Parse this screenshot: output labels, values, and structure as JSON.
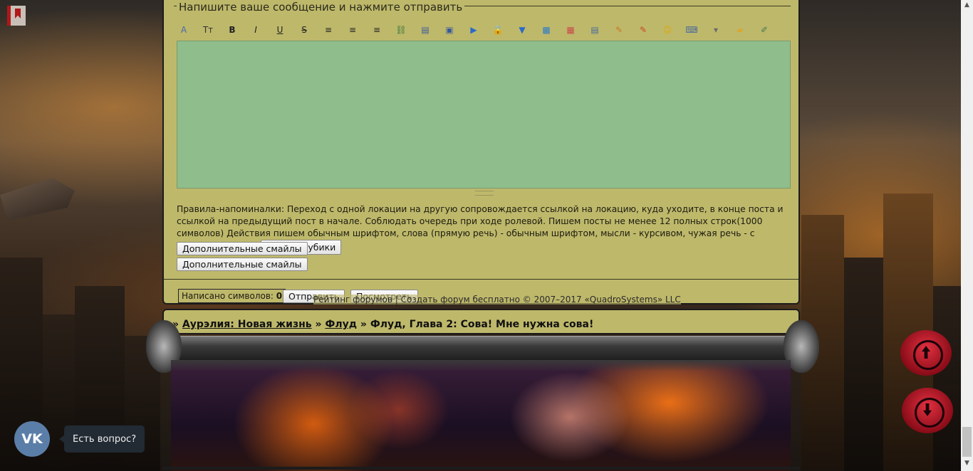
{
  "form": {
    "legend": "Напишите ваше сообщение и нажмите отправить",
    "toolbar": [
      {
        "icon": "font-color-icon",
        "glyph": "A",
        "color": "#4a6aa8"
      },
      {
        "icon": "font-size-icon",
        "glyph": "Tт",
        "color": "#333333"
      },
      {
        "icon": "bold-icon",
        "glyph": "B",
        "color": "#222222"
      },
      {
        "icon": "italic-icon",
        "glyph": "I",
        "color": "#222222"
      },
      {
        "icon": "underline-icon",
        "glyph": "U",
        "color": "#222222"
      },
      {
        "icon": "strikethrough-icon",
        "glyph": "S",
        "color": "#222222"
      },
      {
        "icon": "align-left-icon",
        "glyph": "≡",
        "color": "#222222"
      },
      {
        "icon": "align-center-icon",
        "glyph": "≡",
        "color": "#222222"
      },
      {
        "icon": "align-right-icon",
        "glyph": "≡",
        "color": "#222222"
      },
      {
        "icon": "link-icon",
        "glyph": "⛓",
        "color": "#3a7a3a"
      },
      {
        "icon": "book-icon",
        "glyph": "▤",
        "color": "#3a5a9a"
      },
      {
        "icon": "image-icon",
        "glyph": "▣",
        "color": "#3a5a9a"
      },
      {
        "icon": "video-icon",
        "glyph": "▶",
        "color": "#2a6ac8"
      },
      {
        "icon": "lock-icon",
        "glyph": "🔒",
        "color": "#c89a20"
      },
      {
        "icon": "quote-icon",
        "glyph": "▼",
        "color": "#2a6ac8"
      },
      {
        "icon": "code-icon",
        "glyph": "▩",
        "color": "#2a7ac8"
      },
      {
        "icon": "color-palette-icon",
        "glyph": "▦",
        "color": "#c84a4a"
      },
      {
        "icon": "table-icon",
        "glyph": "▤",
        "color": "#4a6a9a"
      },
      {
        "icon": "pencil-icon",
        "glyph": "✎",
        "color": "#c87a20"
      },
      {
        "icon": "marker-icon",
        "glyph": "✎",
        "color": "#c84a20"
      },
      {
        "icon": "smiley-icon",
        "glyph": "☺",
        "color": "#e0a800"
      },
      {
        "icon": "keyboard-icon",
        "glyph": "⌨",
        "color": "#4a6a9a"
      },
      {
        "icon": "dropdown-icon",
        "glyph": "▾",
        "color": "#6a6a6a"
      },
      {
        "icon": "folder-icon",
        "glyph": "▰",
        "color": "#d8a830"
      },
      {
        "icon": "edit-icon",
        "glyph": "✐",
        "color": "#4a7a4a"
      }
    ],
    "textarea_value": "",
    "rules_text": "Правила-напоминалки: Переход с одной локации на другую сопровождается ссылкой на локацию, куда уходите, в конце поста и ссылкой на предыдущий пост в начале. Соблюдать очередь при ходе ролевой. Пишем посты не менее 12 полных строк(1000 символов) Действия пишем обычным шрифтом, слова (прямую речь) - обычным шрифтом, мысли - курсивом, чужая речь - с подчеркиванием.",
    "dice_button": "Кинуть кубики",
    "extra_smiles_1": "Дополнительные смайлы",
    "extra_smiles_2": "Дополнительные смайлы",
    "counter_label": "Написано символов:",
    "counter_value": "0",
    "submit_button": "Отправить",
    "preview_button": "Посмотреть"
  },
  "footer": {
    "rating_link": "Рейтинг форумов",
    "separator": "|",
    "create_link": "Создать форум бесплатно",
    "copyright": "© 2007–2017 «QuadroSystems» LLC"
  },
  "breadcrumb": {
    "prefix": "»",
    "forum": "Аурэлия: Новая жизнь",
    "sep1": "»",
    "section": "Флуд",
    "sep2": "»",
    "topic": "Флуд, Глава 2: Сова! Мне нужна сова!"
  },
  "widget": {
    "vk_label": "VK",
    "question": "Есть вопрос?"
  },
  "colors": {
    "panel": "#beb86b",
    "textarea": "#8fbd8c",
    "scroll_buttons": "#c81e2e"
  }
}
